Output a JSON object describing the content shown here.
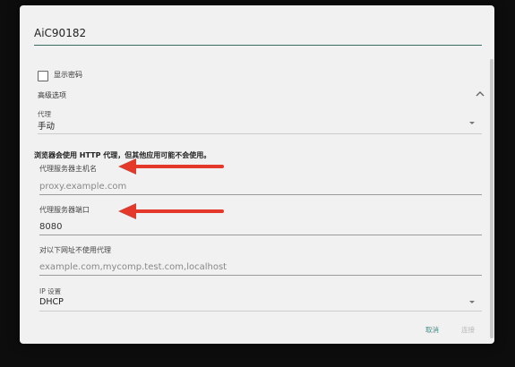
{
  "network": {
    "ssid": "AiC90182"
  },
  "show_password": {
    "label": "显示密码",
    "checked": false
  },
  "advanced": {
    "label": "高级选项",
    "expanded": true
  },
  "proxy": {
    "label": "代理",
    "value": "手动"
  },
  "warning": "浏览器会使用 HTTP 代理，但其他应用可能不会使用。",
  "hostname": {
    "label": "代理服务器主机名",
    "placeholder": "proxy.example.com"
  },
  "port": {
    "label": "代理服务器端口",
    "value": "8080"
  },
  "bypass": {
    "label": "对以下网址不使用代理",
    "placeholder": "example.com,mycomp.test.com,localhost"
  },
  "ip": {
    "label": "IP 设置",
    "value": "DHCP"
  },
  "buttons": {
    "cancel": "取消",
    "connect": "连接"
  },
  "colors": {
    "accent": "#3c8f85",
    "annotation_arrow": "#e4382b"
  }
}
